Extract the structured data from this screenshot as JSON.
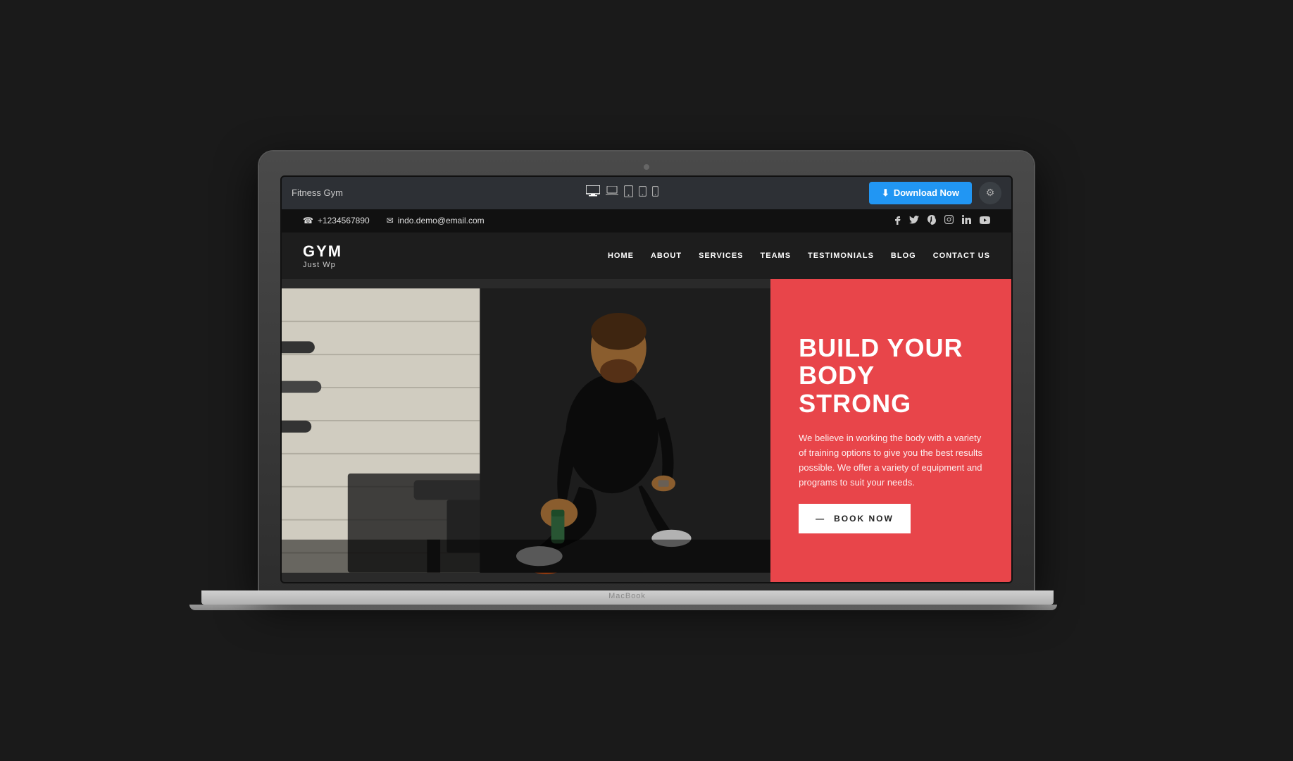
{
  "macbook": {
    "label": "MacBook"
  },
  "builder": {
    "title": "Fitness Gym",
    "download_label": "Download Now",
    "download_icon": "⬇",
    "settings_icon": "⚙"
  },
  "devices": [
    {
      "id": "desktop",
      "icon": "🖥",
      "active": true
    },
    {
      "id": "laptop",
      "icon": "💻",
      "active": false
    },
    {
      "id": "tablet",
      "icon": "📱",
      "active": false
    },
    {
      "id": "tablet-small",
      "icon": "📱",
      "active": false
    },
    {
      "id": "mobile",
      "icon": "📱",
      "active": false
    }
  ],
  "contact_bar": {
    "phone": "+1234567890",
    "email": "indo.demo@email.com",
    "phone_icon": "☎",
    "email_icon": "✉",
    "social": [
      {
        "name": "facebook",
        "icon": "f"
      },
      {
        "name": "twitter",
        "icon": "t"
      },
      {
        "name": "pinterest",
        "icon": "p"
      },
      {
        "name": "instagram",
        "icon": "ig"
      },
      {
        "name": "linkedin",
        "icon": "in"
      },
      {
        "name": "youtube",
        "icon": "yt"
      }
    ]
  },
  "navigation": {
    "logo_main": "GYM",
    "logo_sub": "Just Wp",
    "links": [
      {
        "label": "HOME",
        "active": true
      },
      {
        "label": "ABOUT",
        "active": false
      },
      {
        "label": "SERVICES",
        "active": false
      },
      {
        "label": "TEAMS",
        "active": false
      },
      {
        "label": "TESTIMONIALS",
        "active": false
      },
      {
        "label": "BLOG",
        "active": false
      },
      {
        "label": "CONTACT US",
        "active": false
      }
    ]
  },
  "hero": {
    "headline_line1": "BUILD YOUR BODY",
    "headline_line2": "STRONG",
    "description": "We believe in working the body with a variety of training options to give you the best results possible. We offer a variety of equipment and programs to suit your needs.",
    "cta_label": "BOOK NOW",
    "cta_arrow": "—",
    "bg_color": "#e8454a"
  }
}
